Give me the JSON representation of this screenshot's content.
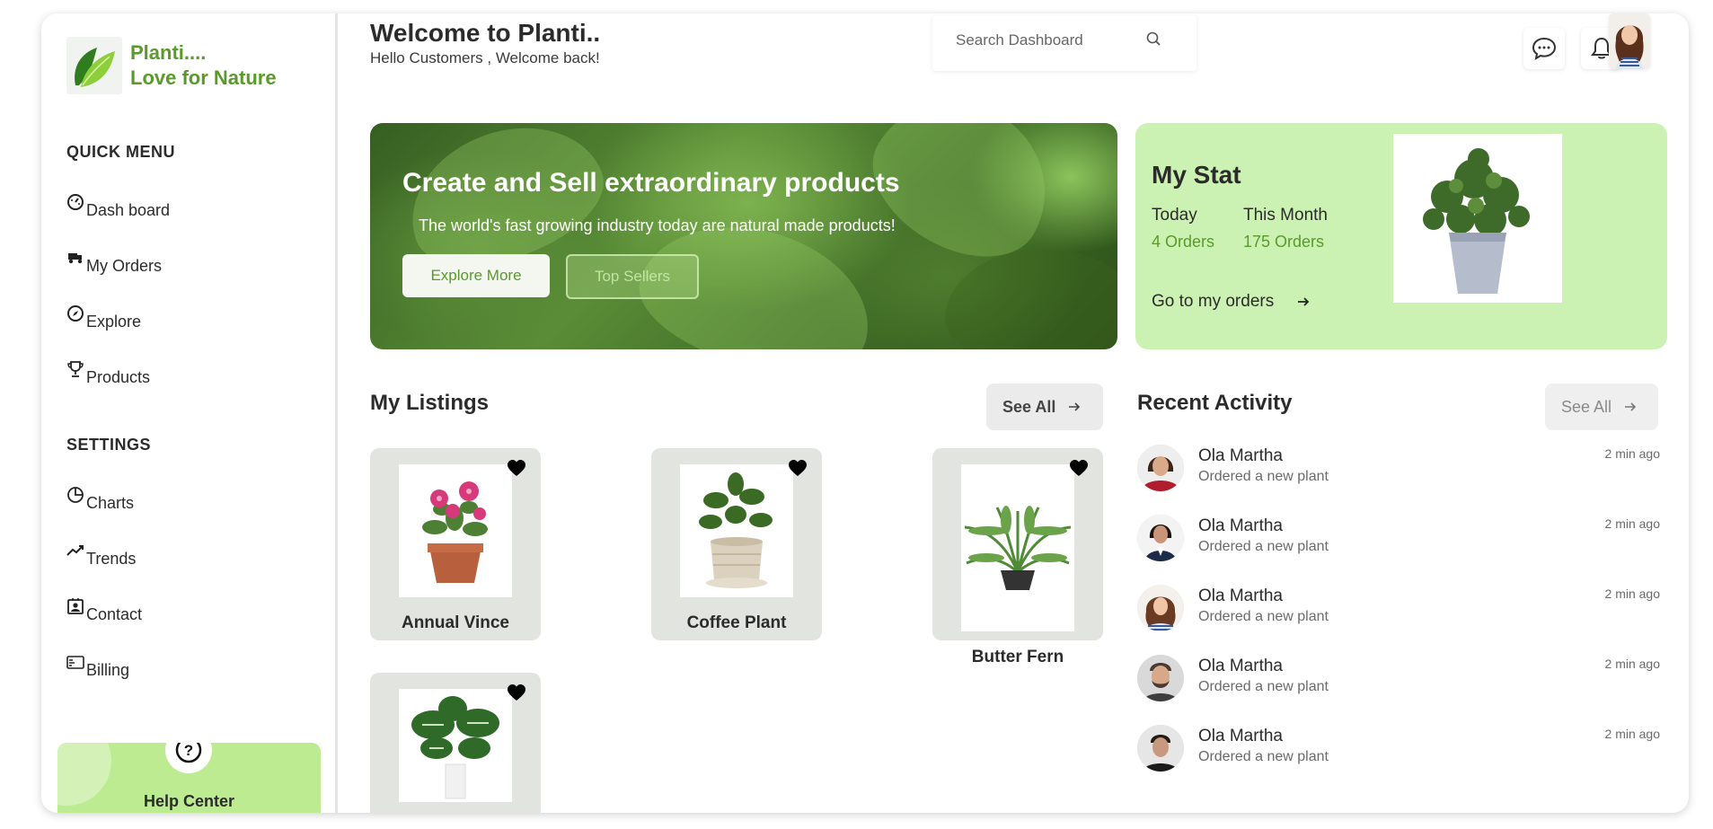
{
  "brand": {
    "line1": "Planti....",
    "line2": "Love for Nature",
    "color": "#5a9a2a"
  },
  "header": {
    "title": "Welcome to Planti..",
    "subtitle": "Hello Customers , Welcome back!",
    "search_placeholder": "Search Dashboard",
    "icons": [
      "search-icon",
      "chat-icon",
      "bell-icon"
    ]
  },
  "sidebar": {
    "quick_menu_heading": "QUICK MENU",
    "quick_items": [
      {
        "label": "Dash board",
        "icon": "dashboard-icon"
      },
      {
        "label": "My Orders",
        "icon": "delivery-icon"
      },
      {
        "label": "Explore",
        "icon": "compass-icon"
      },
      {
        "label": "Products",
        "icon": "trophy-icon"
      }
    ],
    "settings_heading": "SETTINGS",
    "settings_items": [
      {
        "label": "Charts",
        "icon": "pie-chart-icon"
      },
      {
        "label": "Trends",
        "icon": "trend-icon"
      },
      {
        "label": "Contact",
        "icon": "contact-icon"
      },
      {
        "label": "Billing",
        "icon": "card-icon"
      }
    ],
    "help_label": "Help Center"
  },
  "banner": {
    "title": "Create and Sell extraordinary products",
    "text": "The world's fast growing industry today are natural made products!",
    "explore_label": "Explore More",
    "sellers_label": "Top Sellers"
  },
  "stat": {
    "title": "My Stat",
    "today_label": "Today",
    "today_value": "4 Orders",
    "month_label": "This Month",
    "month_value": "175 Orders",
    "goto_label": "Go to my orders",
    "accent": "#5a9a2a",
    "background": "#ccf2b3"
  },
  "listings": {
    "title": "My Listings",
    "see_all": "See All",
    "items": [
      {
        "name": "Annual Vince"
      },
      {
        "name": "Coffee Plant"
      },
      {
        "name": "Butter Fern"
      },
      {
        "name": ""
      }
    ]
  },
  "activity": {
    "title": "Recent Activity",
    "see_all": "See All",
    "items": [
      {
        "name": "Ola Martha",
        "desc": "Ordered a new plant",
        "time": "2 min ago"
      },
      {
        "name": "Ola Martha",
        "desc": "Ordered a new plant",
        "time": "2 min ago"
      },
      {
        "name": "Ola Martha",
        "desc": "Ordered a new plant",
        "time": "2 min ago"
      },
      {
        "name": "Ola Martha",
        "desc": "Ordered a new plant",
        "time": "2 min ago"
      },
      {
        "name": "Ola Martha",
        "desc": "Ordered a new plant",
        "time": "2 min ago"
      }
    ]
  }
}
